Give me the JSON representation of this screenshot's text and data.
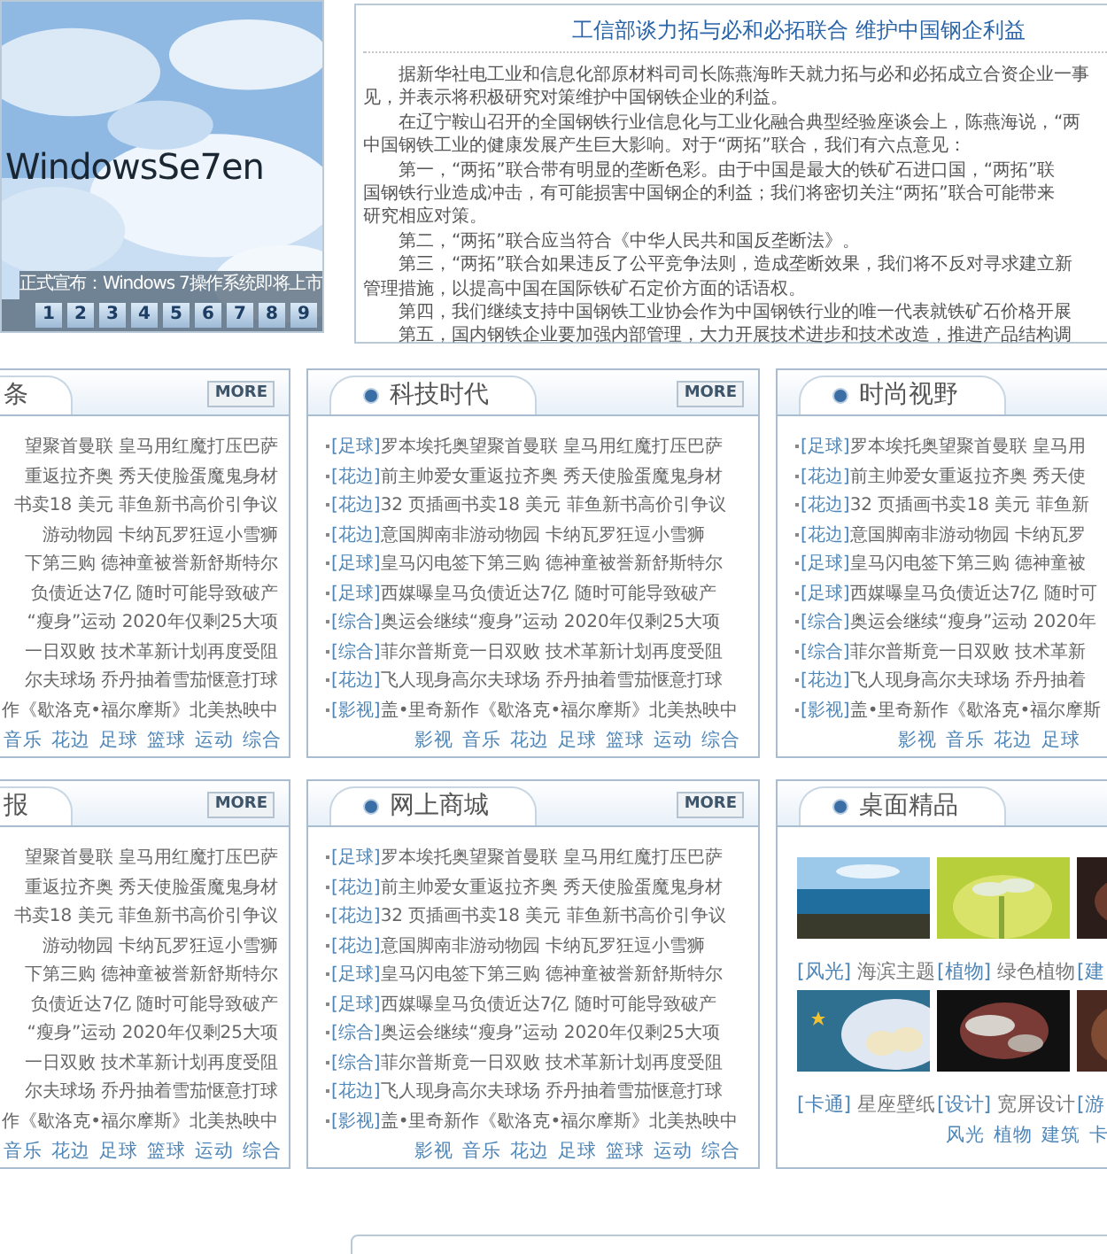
{
  "banner": {
    "logo": "WindowsSe7en",
    "caption": "正式宣布：Windows 7操作系统即将上市",
    "pages": [
      "1",
      "2",
      "3",
      "4",
      "5",
      "6",
      "7",
      "8",
      "9"
    ]
  },
  "article": {
    "title": "工信部谈力拓与必和必拓联合 维护中国钢企利益",
    "paragraphs": [
      [
        "据新华社电工业和信息化部原材料司司长陈燕海昨天就力拓与必和必拓成立合资企业一事",
        "见，并表示将积极研究对策维护中国钢铁企业的利益。"
      ],
      [
        "在辽宁鞍山召开的全国钢铁行业信息化与工业化融合典型经验座谈会上，陈燕海说，“两",
        "中国钢铁工业的健康发展产生巨大影响。对于“两拓”联合，我们有六点意见："
      ],
      [
        "第一，“两拓”联合带有明显的垄断色彩。由于中国是最大的铁矿石进口国，“两拓”联",
        "国钢铁行业造成冲击，有可能损害中国钢企的利益；我们将密切关注“两拓”联合可能带来",
        "研究相应对策。"
      ],
      [
        "第二，“两拓”联合应当符合《中华人民共和国反垄断法》。"
      ],
      [
        "第三，“两拓”联合如果违反了公平竞争法则，造成垄断效果，我们将不反对寻求建立新",
        "管理措施，以提高中国在国际铁矿石定价方面的话语权。"
      ],
      [
        "第四，我们继续支持中国钢铁工业协会作为中国钢铁行业的唯一代表就铁矿石价格开展"
      ],
      [
        "第五，国内钢铁企业要加强内部管理，大力开展技术进步和技术改造，推进产品结构调"
      ]
    ]
  },
  "rows": [
    [
      {
        "kind": "news",
        "title": "条",
        "bullet": false,
        "more": "MORE",
        "items": [
          {
            "text": "望聚首曼联 皇马用红魔打压巴萨"
          },
          {
            "text": "重返拉齐奥 秀天使脸蛋魔鬼身材"
          },
          {
            "text": "书卖18 美元 菲鱼新书高价引争议"
          },
          {
            "text": "游动物园 卡纳瓦罗狂逗小雪狮"
          },
          {
            "text": "下第三购 德神童被誉新舒斯特尔"
          },
          {
            "text": "负债近达7亿 随时可能导致破产"
          },
          {
            "text": "“瘦身”运动 2020年仅剩25大项"
          },
          {
            "text": "一日双败 技术革新计划再度受阻"
          },
          {
            "text": "尔夫球场 乔丹抽着雪茄惬意打球"
          },
          {
            "text": "作《歇洛克•福尔摩斯》北美热映中"
          }
        ],
        "links": [
          "音乐",
          "花边",
          "足球",
          "篮球",
          "运动",
          "综合"
        ]
      },
      {
        "kind": "news",
        "title": "科技时代",
        "bullet": true,
        "more": "MORE",
        "items": [
          {
            "category": "[足球]",
            "text": "罗本埃托奥望聚首曼联 皇马用红魔打压巴萨"
          },
          {
            "category": "[花边]",
            "text": "前主帅爱女重返拉齐奥 秀天使脸蛋魔鬼身材"
          },
          {
            "category": "[花边]",
            "text": "32 页插画书卖18 美元 菲鱼新书高价引争议"
          },
          {
            "category": "[花边]",
            "text": "意国脚南非游动物园 卡纳瓦罗狂逗小雪狮"
          },
          {
            "category": "[足球]",
            "text": "皇马闪电签下第三购 德神童被誉新舒斯特尔"
          },
          {
            "category": "[足球]",
            "text": "西媒曝皇马负债近达7亿 随时可能导致破产"
          },
          {
            "category": "[综合]",
            "text": "奥运会继续“瘦身”运动 2020年仅剩25大项"
          },
          {
            "category": "[综合]",
            "text": "菲尔普斯竟一日双败 技术革新计划再度受阻"
          },
          {
            "category": "[花边]",
            "text": "飞人现身高尔夫球场 乔丹抽着雪茄惬意打球"
          },
          {
            "category": "[影视]",
            "text": "盖•里奇新作《歇洛克•福尔摩斯》北美热映中"
          }
        ],
        "links": [
          "影视",
          "音乐",
          "花边",
          "足球",
          "篮球",
          "运动",
          "综合"
        ]
      },
      {
        "kind": "news",
        "title": "时尚视野",
        "bullet": true,
        "items": [
          {
            "category": "[足球]",
            "text": "罗本埃托奥望聚首曼联 皇马用"
          },
          {
            "category": "[花边]",
            "text": "前主帅爱女重返拉齐奥 秀天使"
          },
          {
            "category": "[花边]",
            "text": "32 页插画书卖18 美元 菲鱼新"
          },
          {
            "category": "[花边]",
            "text": "意国脚南非游动物园 卡纳瓦罗"
          },
          {
            "category": "[足球]",
            "text": "皇马闪电签下第三购 德神童被"
          },
          {
            "category": "[足球]",
            "text": "西媒曝皇马负债近达7亿 随时可"
          },
          {
            "category": "[综合]",
            "text": "奥运会继续“瘦身”运动 2020年"
          },
          {
            "category": "[综合]",
            "text": "菲尔普斯竟一日双败 技术革新"
          },
          {
            "category": "[花边]",
            "text": "飞人现身高尔夫球场 乔丹抽着"
          },
          {
            "category": "[影视]",
            "text": "盖•里奇新作《歇洛克•福尔摩斯"
          }
        ],
        "links": [
          "影视",
          "音乐",
          "花边",
          "足球"
        ]
      }
    ],
    [
      {
        "kind": "news",
        "title": "报",
        "bullet": false,
        "more": "MORE",
        "items": [
          {
            "text": "望聚首曼联 皇马用红魔打压巴萨"
          },
          {
            "text": "重返拉齐奥 秀天使脸蛋魔鬼身材"
          },
          {
            "text": "书卖18 美元 菲鱼新书高价引争议"
          },
          {
            "text": "游动物园 卡纳瓦罗狂逗小雪狮"
          },
          {
            "text": "下第三购 德神童被誉新舒斯特尔"
          },
          {
            "text": "负债近达7亿 随时可能导致破产"
          },
          {
            "text": "“瘦身”运动 2020年仅剩25大项"
          },
          {
            "text": "一日双败 技术革新计划再度受阻"
          },
          {
            "text": "尔夫球场 乔丹抽着雪茄惬意打球"
          },
          {
            "text": "作《歇洛克•福尔摩斯》北美热映中"
          }
        ],
        "links": [
          "音乐",
          "花边",
          "足球",
          "篮球",
          "运动",
          "综合"
        ]
      },
      {
        "kind": "news",
        "title": "网上商城",
        "bullet": true,
        "more": "MORE",
        "items": [
          {
            "category": "[足球]",
            "text": "罗本埃托奥望聚首曼联 皇马用红魔打压巴萨"
          },
          {
            "category": "[花边]",
            "text": "前主帅爱女重返拉齐奥 秀天使脸蛋魔鬼身材"
          },
          {
            "category": "[花边]",
            "text": "32 页插画书卖18 美元 菲鱼新书高价引争议"
          },
          {
            "category": "[花边]",
            "text": "意国脚南非游动物园 卡纳瓦罗狂逗小雪狮"
          },
          {
            "category": "[足球]",
            "text": "皇马闪电签下第三购 德神童被誉新舒斯特尔"
          },
          {
            "category": "[足球]",
            "text": "西媒曝皇马负债近达7亿 随时可能导致破产"
          },
          {
            "category": "[综合]",
            "text": "奥运会继续“瘦身”运动 2020年仅剩25大项"
          },
          {
            "category": "[综合]",
            "text": "菲尔普斯竟一日双败 技术革新计划再度受阻"
          },
          {
            "category": "[花边]",
            "text": "飞人现身高尔夫球场 乔丹抽着雪茄惬意打球"
          },
          {
            "category": "[影视]",
            "text": "盖•里奇新作《歇洛克•福尔摩斯》北美热映中"
          }
        ],
        "links": [
          "影视",
          "音乐",
          "花边",
          "足球",
          "篮球",
          "运动",
          "综合"
        ]
      },
      {
        "kind": "gallery",
        "title": "桌面精品",
        "bullet": true,
        "tiles": [
          {
            "tag": "[风光]",
            "text": "海滨主题"
          },
          {
            "tag": "[植物]",
            "text": "绿色植物"
          },
          {
            "tag": "[建"
          },
          {
            "tag": "[卡通]",
            "text": "星座壁纸"
          },
          {
            "tag": "[设计]",
            "text": "宽屏设计"
          },
          {
            "tag": "[游"
          }
        ],
        "links": [
          "风光",
          "植物",
          "建筑",
          "卡"
        ]
      }
    ]
  ]
}
